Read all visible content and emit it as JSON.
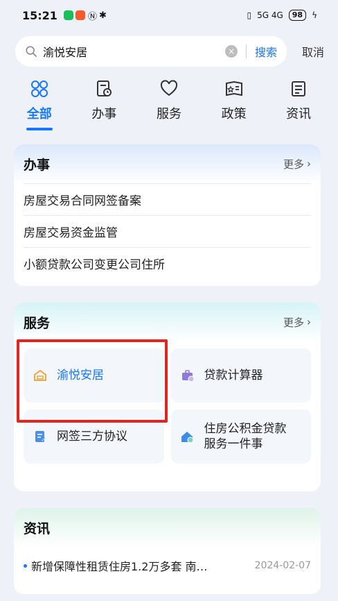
{
  "status": {
    "time": "15:21",
    "signal": "5G 4G",
    "battery": "98"
  },
  "search": {
    "query": "渝悦安居",
    "search_label": "搜索",
    "cancel_label": "取消"
  },
  "tabs": [
    {
      "label": "全部",
      "icon": "grid-icon",
      "active": true
    },
    {
      "label": "办事",
      "icon": "clock-document-icon"
    },
    {
      "label": "服务",
      "icon": "heart-icon"
    },
    {
      "label": "政策",
      "icon": "policy-icon"
    },
    {
      "label": "资讯",
      "icon": "news-icon"
    }
  ],
  "affairs": {
    "title": "办事",
    "more": "更多",
    "items": [
      "房屋交易合同网签备案",
      "房屋交易资金监管",
      "小额贷款公司变更公司住所"
    ]
  },
  "services": {
    "title": "服务",
    "more": "更多",
    "items": [
      {
        "label": "渝悦安居",
        "icon": "house-icon",
        "highlight": true
      },
      {
        "label": "贷款计算器",
        "icon": "briefcase-icon"
      },
      {
        "label": "网签三方协议",
        "icon": "document-edit-icon"
      },
      {
        "label_line1": "住房公积金贷款",
        "label_line2": "服务一件事",
        "icon": "home-fund-icon"
      }
    ]
  },
  "news": {
    "title": "资讯",
    "items": [
      {
        "title": "新增保障性租赁住房1.2万多套 南…",
        "date": "2024-02-07"
      }
    ]
  },
  "colors": {
    "accent": "#1677ff",
    "highlight_box": "#e52420",
    "house_icon": "#f0a030"
  }
}
